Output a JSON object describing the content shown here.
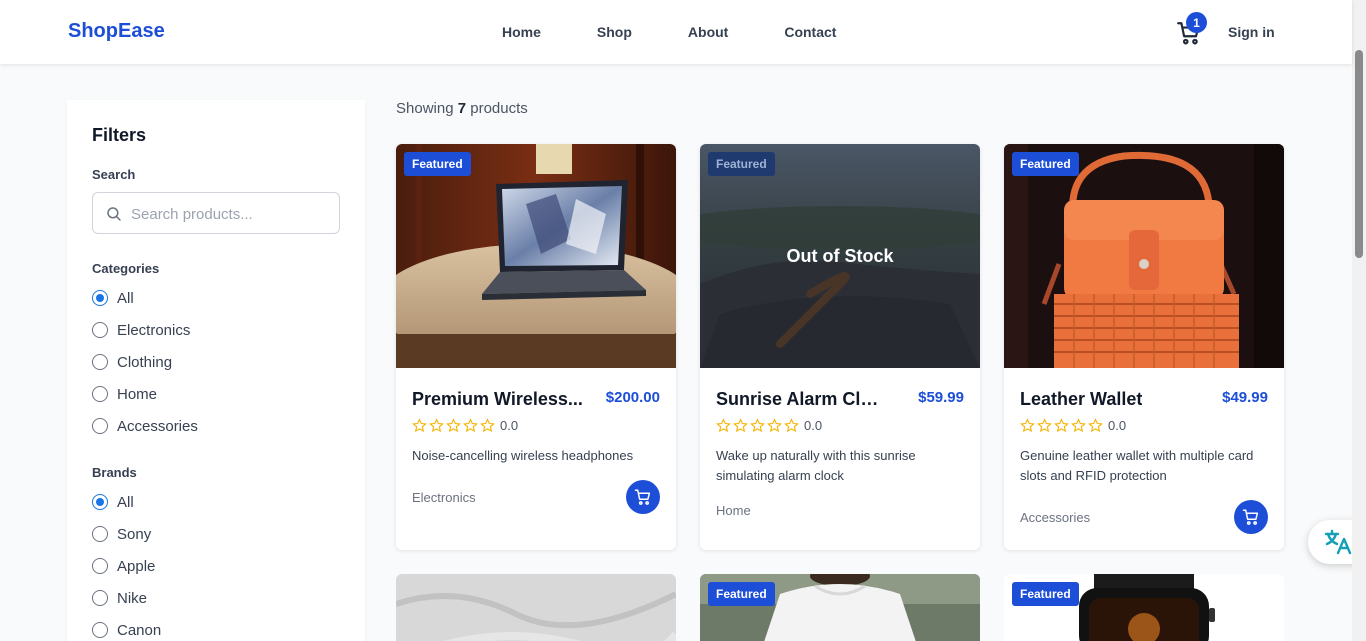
{
  "header": {
    "logo": "ShopEase",
    "nav": [
      "Home",
      "Shop",
      "About",
      "Contact"
    ],
    "cart_count": "1",
    "signin": "Sign in"
  },
  "sidebar": {
    "title": "Filters",
    "search_label": "Search",
    "search_placeholder": "Search products...",
    "categories_label": "Categories",
    "categories": [
      "All",
      "Electronics",
      "Clothing",
      "Home",
      "Accessories"
    ],
    "categories_selected": "All",
    "brands_label": "Brands",
    "brands": [
      "All",
      "Sony",
      "Apple",
      "Nike",
      "Canon"
    ],
    "brands_selected": "All"
  },
  "main": {
    "showing_prefix": "Showing",
    "showing_count": "7",
    "showing_suffix": "products",
    "products": [
      {
        "badge": "Featured",
        "name": "Premium Wireless...",
        "price": "$200.00",
        "rating": "0.0",
        "description": "Noise-cancelling wireless headphones",
        "category": "Electronics",
        "out_of_stock": false
      },
      {
        "badge": "Featured",
        "name": "Sunrise Alarm Clock",
        "price": "$59.99",
        "rating": "0.0",
        "description": "Wake up naturally with this sunrise simulating alarm clock",
        "category": "Home",
        "out_of_stock": true,
        "overlay": "Out of Stock"
      },
      {
        "badge": "Featured",
        "name": "Leather Wallet",
        "price": "$49.99",
        "rating": "0.0",
        "description": "Genuine leather wallet with multiple card slots and RFID protection",
        "category": "Accessories",
        "out_of_stock": false
      }
    ],
    "row2_badges": [
      "Featured",
      "Featured"
    ]
  },
  "colors": {
    "brand": "#1d4ed8",
    "star": "#f5b301",
    "radio_checked": "#1a73e8"
  },
  "icons": [
    "cart-icon",
    "search-icon",
    "star-outline-icon",
    "add-to-cart-icon",
    "translate-icon"
  ]
}
